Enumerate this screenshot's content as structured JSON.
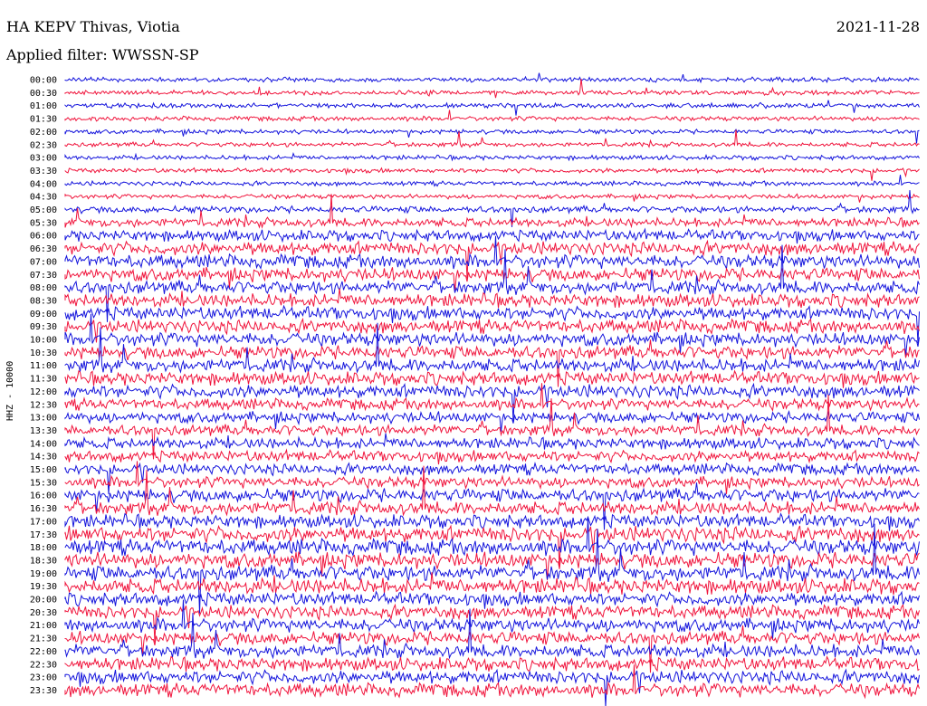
{
  "header": {
    "station": "HA KEPV Thivas, Viotia",
    "date": "2021-11-28",
    "filter": "Applied filter: WWSSN-SP"
  },
  "chart_data": {
    "type": "line",
    "ylabel": "HHZ - 10000",
    "colors": {
      "even": "#1414dc",
      "odd": "#f0143c"
    },
    "rows": [
      "00:00",
      "00:30",
      "01:00",
      "01:30",
      "02:00",
      "02:30",
      "03:00",
      "03:30",
      "04:00",
      "04:30",
      "05:00",
      "05:30",
      "06:00",
      "06:30",
      "07:00",
      "07:30",
      "08:00",
      "08:30",
      "09:00",
      "09:30",
      "10:00",
      "10:30",
      "11:00",
      "11:30",
      "12:00",
      "12:30",
      "13:00",
      "13:30",
      "14:00",
      "14:30",
      "15:00",
      "15:30",
      "16:00",
      "16:30",
      "17:00",
      "17:30",
      "18:00",
      "18:30",
      "19:00",
      "19:30",
      "20:00",
      "20:30",
      "21:00",
      "21:30",
      "22:00",
      "22:30",
      "23:00",
      "23:30"
    ],
    "noise_level": [
      1,
      1,
      1,
      1,
      1,
      1,
      1,
      1,
      1,
      1,
      2,
      3,
      4,
      5,
      5,
      5,
      5,
      5,
      5,
      5,
      5,
      5,
      5,
      5,
      5,
      4,
      4,
      4,
      4,
      4,
      4,
      4,
      5,
      5,
      5,
      6,
      6,
      6,
      6,
      6,
      5,
      5,
      5,
      5,
      5,
      5,
      5,
      5
    ]
  }
}
